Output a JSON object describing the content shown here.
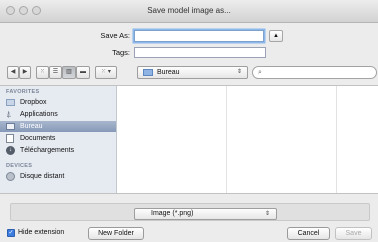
{
  "window": {
    "title": "Save model image as..."
  },
  "form": {
    "save_as_label": "Save As:",
    "save_as_value": "",
    "tags_label": "Tags:",
    "tags_value": ""
  },
  "toolbar": {
    "back_icon": "chevron-left-icon",
    "forward_icon": "chevron-right-icon",
    "location": "Bureau",
    "search_value": ""
  },
  "sidebar": {
    "favorites_header": "FAVORITES",
    "devices_header": "DEVICES",
    "favorites": [
      {
        "label": "Dropbox",
        "icon": "folder-icon"
      },
      {
        "label": "Applications",
        "icon": "applications-icon"
      },
      {
        "label": "Bureau",
        "icon": "desktop-icon",
        "selected": true
      },
      {
        "label": "Documents",
        "icon": "documents-icon"
      },
      {
        "label": "Téléchargements",
        "icon": "download-icon"
      }
    ],
    "devices": [
      {
        "label": "Disque distant",
        "icon": "disk-icon"
      }
    ]
  },
  "bottom": {
    "format": "Image (*.png)",
    "hide_extension_label": "Hide extension",
    "hide_extension_checked": true,
    "new_folder_label": "New Folder",
    "cancel_label": "Cancel",
    "save_label": "Save"
  }
}
